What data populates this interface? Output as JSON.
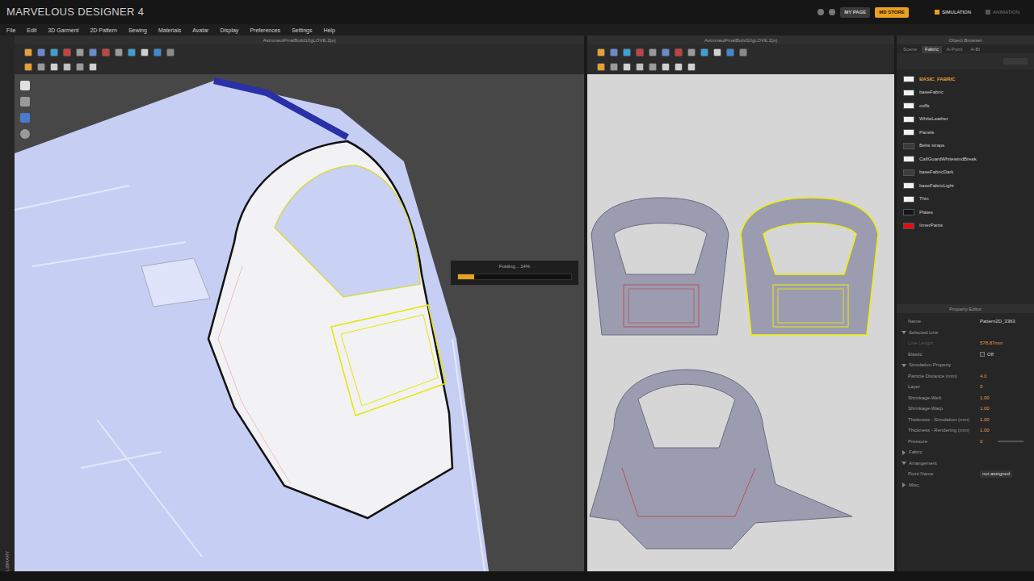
{
  "app": {
    "title": "MARVELOUS DESIGNER 4"
  },
  "top_buttons": [
    {
      "label": "MY PAGE",
      "highlighted": false
    },
    {
      "label": "MD STORE",
      "highlighted": true
    }
  ],
  "modes": [
    {
      "label": "SIMULATION",
      "selected": true
    },
    {
      "label": "ANIMATION",
      "selected": false
    }
  ],
  "menu": [
    "File",
    "Edit",
    "3D Garment",
    "2D Pattern",
    "Sewing",
    "Materials",
    "Avatar",
    "Display",
    "Preferences",
    "Settings",
    "Help"
  ],
  "library": {
    "label": "LIBRARY"
  },
  "view3d": {
    "title": "AstronautFinalBuild10gLOVE.Zprj"
  },
  "progress": {
    "label": "Folding... 14%",
    "level": 0.14
  },
  "view2d": {
    "title": "AstronautFinalBuild10gLOVE.Zprj"
  },
  "object_browser": {
    "title": "Object Browser",
    "tabs": [
      {
        "label": "Scene",
        "selected": false
      },
      {
        "label": "Fabric",
        "selected": true
      },
      {
        "label": "A-Point",
        "selected": false
      },
      {
        "label": "A-Bl",
        "selected": false
      }
    ],
    "fabrics": [
      {
        "name": "BASIC_FABRIC",
        "selected": true,
        "color": "#f2f2f2"
      },
      {
        "name": "baseFabric",
        "selected": false,
        "color": "#f2f2f2"
      },
      {
        "name": "cuffs",
        "selected": false,
        "color": "#f2f2f2"
      },
      {
        "name": "WhiteLeather",
        "selected": false,
        "color": "#f2f2f2"
      },
      {
        "name": "Panels",
        "selected": false,
        "color": "#f2f2f2"
      },
      {
        "name": "Belts straps",
        "selected": false,
        "color": "#3a3a3a"
      },
      {
        "name": "CalfGuardWhitewindBreak",
        "selected": false,
        "color": "#f2f2f2"
      },
      {
        "name": "baseFabricDark",
        "selected": false,
        "color": "#3c3c3c"
      },
      {
        "name": "baseFabricLight",
        "selected": false,
        "color": "#f2f2f2"
      },
      {
        "name": "Thin",
        "selected": false,
        "color": "#f2f2f2"
      },
      {
        "name": "Plates",
        "selected": false,
        "color": "#141414"
      },
      {
        "name": "InnerPants",
        "selected": false,
        "color": "#e01010"
      }
    ]
  },
  "property_editor": {
    "title": "Property Editor",
    "rows": [
      {
        "kind": "text",
        "label": "Name",
        "value": "Pattern2D_3363",
        "disabled": false
      },
      {
        "kind": "section",
        "label": "Selected Line",
        "expanded": true,
        "disabled": false
      },
      {
        "kind": "number",
        "label": "Line Length",
        "value": "578.87mm",
        "disabled": true
      },
      {
        "kind": "toggle",
        "label": "Elastic",
        "value": "Off",
        "checked": false,
        "disabled": false
      },
      {
        "kind": "section",
        "label": "Simulation Property",
        "expanded": true,
        "disabled": false
      },
      {
        "kind": "number",
        "label": "Particle Distance (mm)",
        "value": "4.0",
        "disabled": false
      },
      {
        "kind": "number",
        "label": "Layer",
        "value": "0",
        "disabled": false
      },
      {
        "kind": "number",
        "label": "Shrinkage-Weft",
        "value": "1.00",
        "disabled": false
      },
      {
        "kind": "number",
        "label": "Shrinkage-Warp",
        "value": "1.00",
        "disabled": false
      },
      {
        "kind": "number",
        "label": "Thickness - Simulation (mm)",
        "value": "1.00",
        "disabled": false
      },
      {
        "kind": "number",
        "label": "Thickness - Rendering (mm)",
        "value": "1.00",
        "disabled": false
      },
      {
        "kind": "slider",
        "label": "Pressure",
        "value": "0",
        "level": 0,
        "disabled": false
      },
      {
        "kind": "section",
        "label": "Fabric",
        "expanded": false,
        "disabled": false
      },
      {
        "kind": "section",
        "label": "Arrangement",
        "expanded": true,
        "disabled": false
      },
      {
        "kind": "text",
        "label": "Point Name",
        "value": "not assigned",
        "disabled": false
      },
      {
        "kind": "section",
        "label": "Misc.",
        "expanded": false,
        "disabled": false
      }
    ]
  }
}
